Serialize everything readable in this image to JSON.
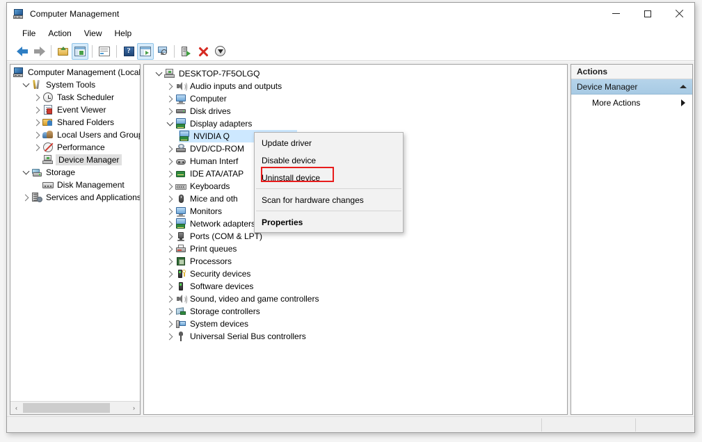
{
  "window": {
    "title": "Computer Management",
    "title_icon": "computer-management-icon",
    "controls": {
      "minimize": "Minimize",
      "maximize": "Maximize",
      "close": "Close"
    }
  },
  "menubar": {
    "items": [
      {
        "label": "File"
      },
      {
        "label": "Action"
      },
      {
        "label": "View"
      },
      {
        "label": "Help"
      }
    ]
  },
  "toolbar": {
    "buttons": [
      {
        "name": "back-button",
        "icon": "arrow-left-icon",
        "title": "Back"
      },
      {
        "name": "forward-button",
        "icon": "arrow-right-icon",
        "title": "Forward"
      },
      {
        "name": "up-one-level-button",
        "icon": "folder-up-icon",
        "title": "Up one level"
      },
      {
        "name": "show-hide-console-tree-button",
        "icon": "console-tree-icon",
        "title": "Show/Hide Console Tree"
      },
      {
        "name": "properties-button",
        "icon": "properties-icon",
        "title": "Properties"
      },
      {
        "name": "help-button",
        "icon": "help-icon",
        "title": "Help"
      },
      {
        "name": "show-hide-action-pane-button",
        "icon": "action-pane-icon",
        "title": "Show/Hide Action Pane"
      },
      {
        "name": "scan-hardware-button",
        "icon": "monitor-scan-icon",
        "title": "Scan for hardware changes"
      },
      {
        "name": "update-driver-button",
        "icon": "update-driver-icon",
        "title": "Update driver"
      },
      {
        "name": "uninstall-device-button",
        "icon": "red-x-icon",
        "title": "Uninstall device"
      },
      {
        "name": "disable-device-button",
        "icon": "down-arrow-circle-icon",
        "title": "Disable device"
      }
    ]
  },
  "console_tree": {
    "items": [
      {
        "label": "Computer Management (Local",
        "icon": "computer-management-icon",
        "depth": 0,
        "expander": "none",
        "selected": false
      },
      {
        "label": "System Tools",
        "icon": "system-tools-icon",
        "depth": 1,
        "expander": "open",
        "selected": false
      },
      {
        "label": "Task Scheduler",
        "icon": "task-scheduler-icon",
        "depth": 2,
        "expander": "closed",
        "selected": false
      },
      {
        "label": "Event Viewer",
        "icon": "event-viewer-icon",
        "depth": 2,
        "expander": "closed",
        "selected": false
      },
      {
        "label": "Shared Folders",
        "icon": "shared-folders-icon",
        "depth": 2,
        "expander": "closed",
        "selected": false
      },
      {
        "label": "Local Users and Groups",
        "icon": "local-users-groups-icon",
        "depth": 2,
        "expander": "closed",
        "selected": false
      },
      {
        "label": "Performance",
        "icon": "performance-icon",
        "depth": 2,
        "expander": "closed",
        "selected": false
      },
      {
        "label": "Device Manager",
        "icon": "device-manager-icon",
        "depth": 2,
        "expander": "none",
        "selected": true
      },
      {
        "label": "Storage",
        "icon": "storage-icon",
        "depth": 1,
        "expander": "open",
        "selected": false
      },
      {
        "label": "Disk Management",
        "icon": "disk-management-icon",
        "depth": 2,
        "expander": "none",
        "selected": false
      },
      {
        "label": "Services and Applications",
        "icon": "services-applications-icon",
        "depth": 1,
        "expander": "closed",
        "selected": false
      }
    ],
    "hscrollbar": {
      "left_arrow": "‹",
      "right_arrow": "›"
    }
  },
  "device_tree": {
    "items": [
      {
        "label": "DESKTOP-7F5OLGQ",
        "icon": "computer-root-icon",
        "depth": 0,
        "expander": "open",
        "selected": false
      },
      {
        "label": "Audio inputs and outputs",
        "icon": "speaker-icon",
        "depth": 1,
        "expander": "closed",
        "selected": false
      },
      {
        "label": "Computer",
        "icon": "monitor-icon",
        "depth": 1,
        "expander": "closed",
        "selected": false
      },
      {
        "label": "Disk drives",
        "icon": "hard-disk-icon",
        "depth": 1,
        "expander": "closed",
        "selected": false
      },
      {
        "label": "Display adapters",
        "icon": "display-adapter-icon",
        "depth": 1,
        "expander": "open",
        "selected": false
      },
      {
        "label": "NVIDIA Q",
        "icon": "display-adapter-icon",
        "depth": 2,
        "expander": "none",
        "selected": true
      },
      {
        "label": "DVD/CD-ROM",
        "icon": "dvd-drive-icon",
        "depth": 1,
        "expander": "closed",
        "selected": false
      },
      {
        "label": "Human Interf",
        "icon": "human-interface-icon",
        "depth": 1,
        "expander": "closed",
        "selected": false
      },
      {
        "label": "IDE ATA/ATAP",
        "icon": "ide-controller-icon",
        "depth": 1,
        "expander": "closed",
        "selected": false
      },
      {
        "label": "Keyboards",
        "icon": "keyboard-icon",
        "depth": 1,
        "expander": "closed",
        "selected": false
      },
      {
        "label": "Mice and oth",
        "icon": "mouse-icon",
        "depth": 1,
        "expander": "closed",
        "selected": false
      },
      {
        "label": "Monitors",
        "icon": "monitor-icon",
        "depth": 1,
        "expander": "closed",
        "selected": false
      },
      {
        "label": "Network adapters",
        "icon": "network-adapter-icon",
        "depth": 1,
        "expander": "closed",
        "selected": false
      },
      {
        "label": "Ports (COM & LPT)",
        "icon": "port-icon",
        "depth": 1,
        "expander": "closed",
        "selected": false
      },
      {
        "label": "Print queues",
        "icon": "printer-icon",
        "depth": 1,
        "expander": "closed",
        "selected": false
      },
      {
        "label": "Processors",
        "icon": "processor-icon",
        "depth": 1,
        "expander": "closed",
        "selected": false
      },
      {
        "label": "Security devices",
        "icon": "security-device-icon",
        "depth": 1,
        "expander": "closed",
        "selected": false
      },
      {
        "label": "Software devices",
        "icon": "software-device-icon",
        "depth": 1,
        "expander": "closed",
        "selected": false
      },
      {
        "label": "Sound, video and game controllers",
        "icon": "speaker-icon",
        "depth": 1,
        "expander": "closed",
        "selected": false
      },
      {
        "label": "Storage controllers",
        "icon": "storage-controller-icon",
        "depth": 1,
        "expander": "closed",
        "selected": false
      },
      {
        "label": "System devices",
        "icon": "system-device-icon",
        "depth": 1,
        "expander": "closed",
        "selected": false
      },
      {
        "label": "Universal Serial Bus controllers",
        "icon": "usb-controller-icon",
        "depth": 1,
        "expander": "closed",
        "selected": false
      }
    ]
  },
  "context_menu": {
    "items": [
      {
        "label": "Update driver",
        "bold": false,
        "separator_after": false,
        "highlighted": false
      },
      {
        "label": "Disable device",
        "bold": false,
        "separator_after": false,
        "highlighted": false
      },
      {
        "label": "Uninstall device",
        "bold": false,
        "separator_after": true,
        "highlighted": true
      },
      {
        "label": "Scan for hardware changes",
        "bold": false,
        "separator_after": true,
        "highlighted": false
      },
      {
        "label": "Properties",
        "bold": true,
        "separator_after": false,
        "highlighted": false
      }
    ],
    "highlight_color": "#e81c1c"
  },
  "actions_panel": {
    "header": "Actions",
    "group": {
      "label": "Device Manager",
      "collapse_icon": "chevron-up-icon"
    },
    "items": [
      {
        "label": "More Actions",
        "submenu_icon": "chevron-right-icon"
      }
    ]
  },
  "statusbar": {
    "text": ""
  },
  "colors": {
    "selection_blue": "#cde8ff",
    "selection_gray": "#e0e0e0",
    "actions_group": "#a7cae4",
    "highlight_red": "#e81c1c"
  }
}
